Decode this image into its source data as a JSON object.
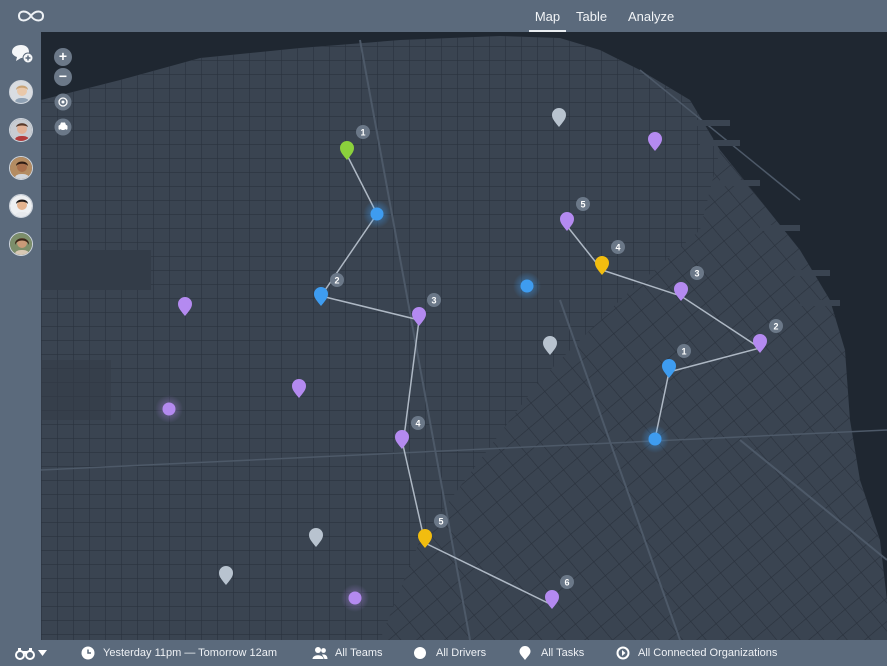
{
  "header": {
    "logo_icon": "infinity-logo",
    "tabs": [
      {
        "label": "Map",
        "active": true
      },
      {
        "label": "Table",
        "active": false
      },
      {
        "label": "Analyze",
        "active": false
      }
    ]
  },
  "sidebar": {
    "icons": [
      "add-chat-icon"
    ],
    "avatars": [
      "driver-avatar-1",
      "driver-avatar-2",
      "driver-avatar-3",
      "driver-avatar-4",
      "driver-avatar-5"
    ]
  },
  "map": {
    "controls": {
      "zoom_in": "+",
      "zoom_out": "−"
    },
    "colors": {
      "purple": "#b48af0",
      "blue": "#3e9cf0",
      "yellow": "#f2bd0f",
      "green": "#8bd13c",
      "gray": "#b8c3cf"
    },
    "route_labels": [
      "1",
      "2",
      "3",
      "4",
      "5",
      "6",
      "1",
      "2",
      "3",
      "4",
      "5"
    ]
  },
  "footer": {
    "date_range": "Yesterday 11pm — Tomorrow 12am",
    "teams": "All Teams",
    "drivers": "All Drivers",
    "tasks": "All Tasks",
    "organizations": "All Connected Organizations"
  }
}
